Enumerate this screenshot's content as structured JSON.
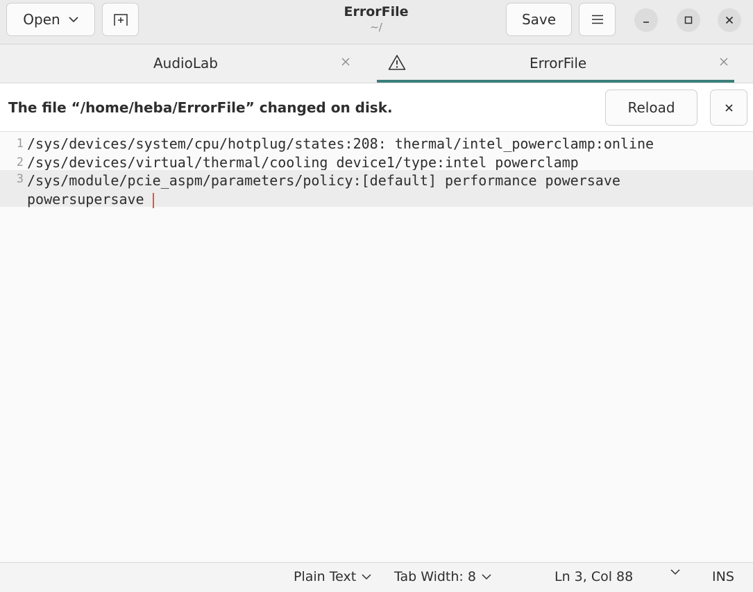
{
  "header": {
    "open_label": "Open",
    "title": "ErrorFile",
    "subtitle": "~/",
    "save_label": "Save",
    "icons": {
      "open_dropdown": "chevron-down-icon",
      "new_tab": "new-tab-icon",
      "menu": "hamburger-menu-icon",
      "minimize": "minimize-icon",
      "maximize": "maximize-icon",
      "close": "close-icon"
    }
  },
  "tabs": [
    {
      "label": "AudioLab",
      "active": false
    },
    {
      "label": "ErrorFile",
      "active": true,
      "icon": "warning-icon"
    }
  ],
  "infobar": {
    "message": "The file “/home/heba/ErrorFile” changed on disk.",
    "reload_label": "Reload"
  },
  "editor": {
    "lines": [
      {
        "number": "1",
        "text": "/sys/devices/system/cpu/hotplug/states:208: thermal/intel_powerclamp:online"
      },
      {
        "number": "2",
        "text": "/sys/devices/virtual/thermal/cooling_device1/type:intel_powerclamp"
      },
      {
        "number": "3",
        "text": "/sys/module/pcie_aspm/parameters/policy:[default] performance powersave powersupersave"
      }
    ]
  },
  "statusbar": {
    "language": "Plain Text",
    "tab_width": "Tab Width: 8",
    "position": "Ln 3, Col 88",
    "mode": "INS"
  },
  "colors": {
    "accent": "#3a7f7b",
    "cursor": "#e5533b",
    "header_bg": "#ebebeb",
    "current_line_bg": "#ececec"
  }
}
